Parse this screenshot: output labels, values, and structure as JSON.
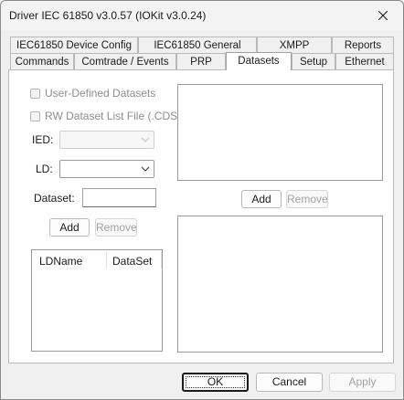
{
  "window": {
    "title": "Driver IEC 61850 v3.0.57 (IOKit v3.0.24)"
  },
  "tabs_row1": [
    {
      "label": "IEC61850 Device Config"
    },
    {
      "label": "IEC61850 General"
    },
    {
      "label": "XMPP"
    },
    {
      "label": "Reports"
    }
  ],
  "tabs_row2": [
    {
      "label": "Commands"
    },
    {
      "label": "Comtrade / Events"
    },
    {
      "label": "PRP"
    },
    {
      "label": "Datasets",
      "active": true
    },
    {
      "label": "Setup"
    },
    {
      "label": "Ethernet"
    }
  ],
  "datasets": {
    "user_defined_label": "User-Defined Datasets",
    "rw_list_label": "RW Dataset List File (.CDS)",
    "ied_label": "IED:",
    "ld_label": "LD:",
    "dataset_label": "Dataset:",
    "dataset_value": "",
    "add_label": "Add",
    "remove_label": "Remove",
    "columns": [
      "LDName",
      "DataSet"
    ],
    "right_add_label": "Add",
    "right_remove_label": "Remove"
  },
  "footer": {
    "ok": "OK",
    "cancel": "Cancel",
    "apply": "Apply"
  }
}
